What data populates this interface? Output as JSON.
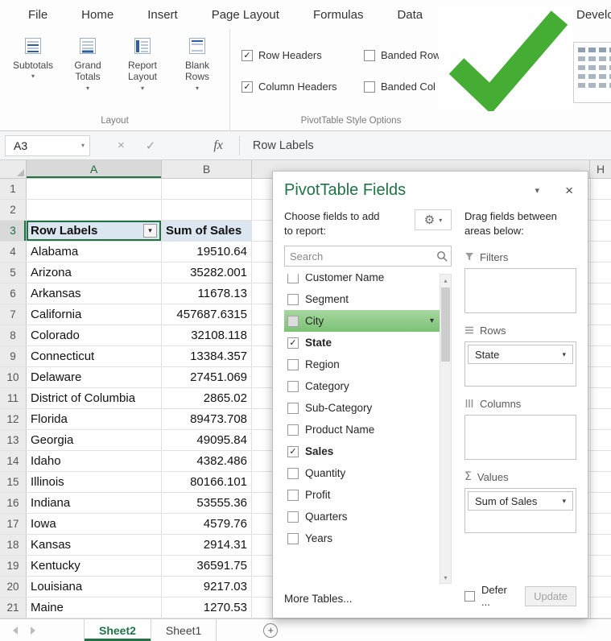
{
  "colors": {
    "accent": "#217346",
    "check_green": "#45AC34",
    "field_highlight": "#8FCF89",
    "pivot_header_fill": "#DCE6F1"
  },
  "ribbon": {
    "tabs": [
      {
        "label": "File"
      },
      {
        "label": "Home"
      },
      {
        "label": "Insert"
      },
      {
        "label": "Page Layout"
      },
      {
        "label": "Formulas"
      },
      {
        "label": "Data"
      },
      {
        "label": "Develop",
        "detached": true
      }
    ],
    "buttons": [
      {
        "label": "Subtotals"
      },
      {
        "label": "Grand Totals"
      },
      {
        "label": "Report Layout"
      },
      {
        "label": "Blank Rows"
      }
    ],
    "checkboxes": [
      {
        "label": "Row Headers",
        "checked": true
      },
      {
        "label": "Banded Row",
        "checked": false
      },
      {
        "label": "Column Headers",
        "checked": true
      },
      {
        "label": "Banded Col",
        "checked": false
      }
    ],
    "groups": [
      "Layout",
      "PivotTable Style Options"
    ]
  },
  "formula_bar": {
    "cell_ref": "A3",
    "fx_label": "fx",
    "value": "Row Labels"
  },
  "grid": {
    "columns": [
      "A",
      "B"
    ],
    "right_column": "H",
    "rows": [
      {
        "n": 1,
        "a": "",
        "b": ""
      },
      {
        "n": 2,
        "a": "",
        "b": ""
      },
      {
        "n": 3,
        "a": "Row Labels",
        "b": "Sum of Sales",
        "header": true
      },
      {
        "n": 4,
        "a": "Alabama",
        "b": "19510.64"
      },
      {
        "n": 5,
        "a": "Arizona",
        "b": "35282.001"
      },
      {
        "n": 6,
        "a": "Arkansas",
        "b": "11678.13"
      },
      {
        "n": 7,
        "a": "California",
        "b": "457687.6315"
      },
      {
        "n": 8,
        "a": "Colorado",
        "b": "32108.118"
      },
      {
        "n": 9,
        "a": "Connecticut",
        "b": "13384.357"
      },
      {
        "n": 10,
        "a": "Delaware",
        "b": "27451.069"
      },
      {
        "n": 11,
        "a": "District of Columbia",
        "b": "2865.02"
      },
      {
        "n": 12,
        "a": "Florida",
        "b": "89473.708"
      },
      {
        "n": 13,
        "a": "Georgia",
        "b": "49095.84"
      },
      {
        "n": 14,
        "a": "Idaho",
        "b": "4382.486"
      },
      {
        "n": 15,
        "a": "Illinois",
        "b": "80166.101"
      },
      {
        "n": 16,
        "a": "Indiana",
        "b": "53555.36"
      },
      {
        "n": 17,
        "a": "Iowa",
        "b": "4579.76"
      },
      {
        "n": 18,
        "a": "Kansas",
        "b": "2914.31"
      },
      {
        "n": 19,
        "a": "Kentucky",
        "b": "36591.75"
      },
      {
        "n": 20,
        "a": "Louisiana",
        "b": "9217.03"
      },
      {
        "n": 21,
        "a": "Maine",
        "b": "1270.53"
      }
    ]
  },
  "pane": {
    "title": "PivotTable Fields",
    "choose_label": "Choose fields to add to report:",
    "search_placeholder": "Search",
    "fields": [
      {
        "name": "Customer Name",
        "checked": false,
        "clipped": true
      },
      {
        "name": "Segment",
        "checked": false
      },
      {
        "name": "City",
        "checked": false,
        "highlighted": true
      },
      {
        "name": "State",
        "checked": true
      },
      {
        "name": "Region",
        "checked": false
      },
      {
        "name": "Category",
        "checked": false
      },
      {
        "name": "Sub-Category",
        "checked": false
      },
      {
        "name": "Product Name",
        "checked": false
      },
      {
        "name": "Sales",
        "checked": true
      },
      {
        "name": "Quantity",
        "checked": false
      },
      {
        "name": "Profit",
        "checked": false
      },
      {
        "name": "Quarters",
        "checked": false
      },
      {
        "name": "Years",
        "checked": false
      }
    ],
    "more_tables": "More Tables...",
    "drag_label": "Drag fields between areas below:",
    "areas": {
      "filters": {
        "label": "Filters",
        "items": []
      },
      "rows": {
        "label": "Rows",
        "items": [
          "State"
        ]
      },
      "columns": {
        "label": "Columns",
        "items": []
      },
      "values": {
        "label": "Values",
        "items": [
          "Sum of Sales"
        ]
      }
    },
    "defer_label": "Defer ...",
    "update_label": "Update"
  },
  "sheet_tabs": {
    "tabs": [
      {
        "label": "Sheet2",
        "active": true
      },
      {
        "label": "Sheet1",
        "active": false
      }
    ]
  }
}
